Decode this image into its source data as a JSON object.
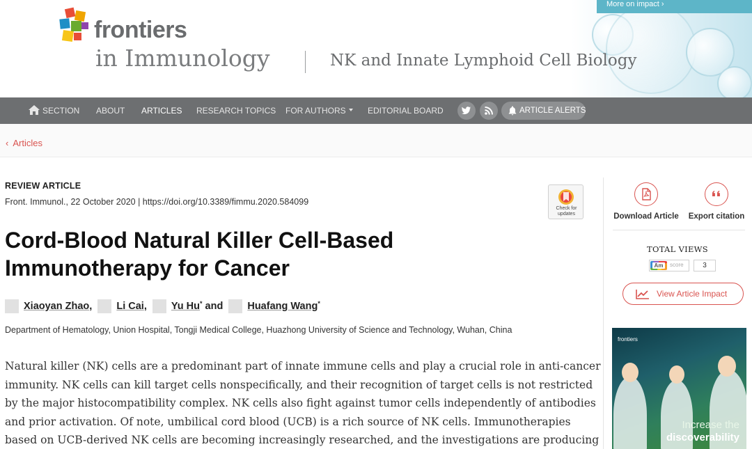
{
  "header": {
    "impact_banner": "More on impact ›",
    "logo_text": "frontiers",
    "journal_name": "in Immunology",
    "section_name": "NK and Innate Lymphoid Cell Biology"
  },
  "nav": {
    "items": [
      {
        "label": "SECTION",
        "icon": "home-icon"
      },
      {
        "label": "ABOUT"
      },
      {
        "label": "ARTICLES",
        "active": true
      },
      {
        "label": "RESEARCH TOPICS"
      },
      {
        "label": "FOR AUTHORS",
        "dropdown": true
      },
      {
        "label": "EDITORIAL BOARD"
      }
    ],
    "social": [
      "twitter-icon",
      "rss-icon"
    ],
    "alerts_label": "ARTICLE ALERTS"
  },
  "breadcrumb": {
    "back_label": "Articles"
  },
  "article": {
    "type": "REVIEW ARTICLE",
    "citation": "Front. Immunol., 22 October 2020 | https://doi.org/10.3389/fimmu.2020.584099",
    "check_updates": "Check for updates",
    "title_line1": "Cord-Blood Natural Killer Cell-Based",
    "title_line2": "Immunotherapy for Cancer",
    "authors": [
      {
        "name": "Xiaoyan Zhao",
        "sup": "",
        "sep": ","
      },
      {
        "name": "Li Cai",
        "sup": "",
        "sep": ","
      },
      {
        "name": "Yu Hu",
        "sup": "*",
        "sep": " and"
      },
      {
        "name": "Huafang Wang",
        "sup": "*",
        "sep": ""
      }
    ],
    "affiliation": "Department of Hematology, Union Hospital, Tongji Medical College, Huazhong University of Science and Technology, Wuhan, China",
    "abstract_lines": [
      "Natural killer (NK) cells are a predominant part of innate immune cells and play a crucial role in anti-cancer",
      "immunity. NK cells can kill target cells nonspecifically, and their recognition of target cells is not restricted",
      "by the major histocompatibility complex. NK cells also fight against tumor cells independently of antibodies",
      "and prior activation. Of note, umbilical cord blood (UCB) is a rich source of NK cells. Immunotherapies",
      "based on UCB-derived NK cells are becoming increasingly researched, and the investigations are producing"
    ]
  },
  "sidebar": {
    "download_label": "Download Article",
    "export_label": "Export citation",
    "total_views_label": "TOTAL VIEWS",
    "altmetric_label": "Am",
    "altmetric_score_label": "score",
    "views_count": "3",
    "impact_button": "View Article Impact",
    "ad": {
      "logo": "frontiers",
      "line1": "Increase the",
      "line2": "discoverability"
    }
  },
  "colors": {
    "accent": "#d9534f",
    "nav_bg": "#6d6f71",
    "banner": "#5db5c8"
  }
}
